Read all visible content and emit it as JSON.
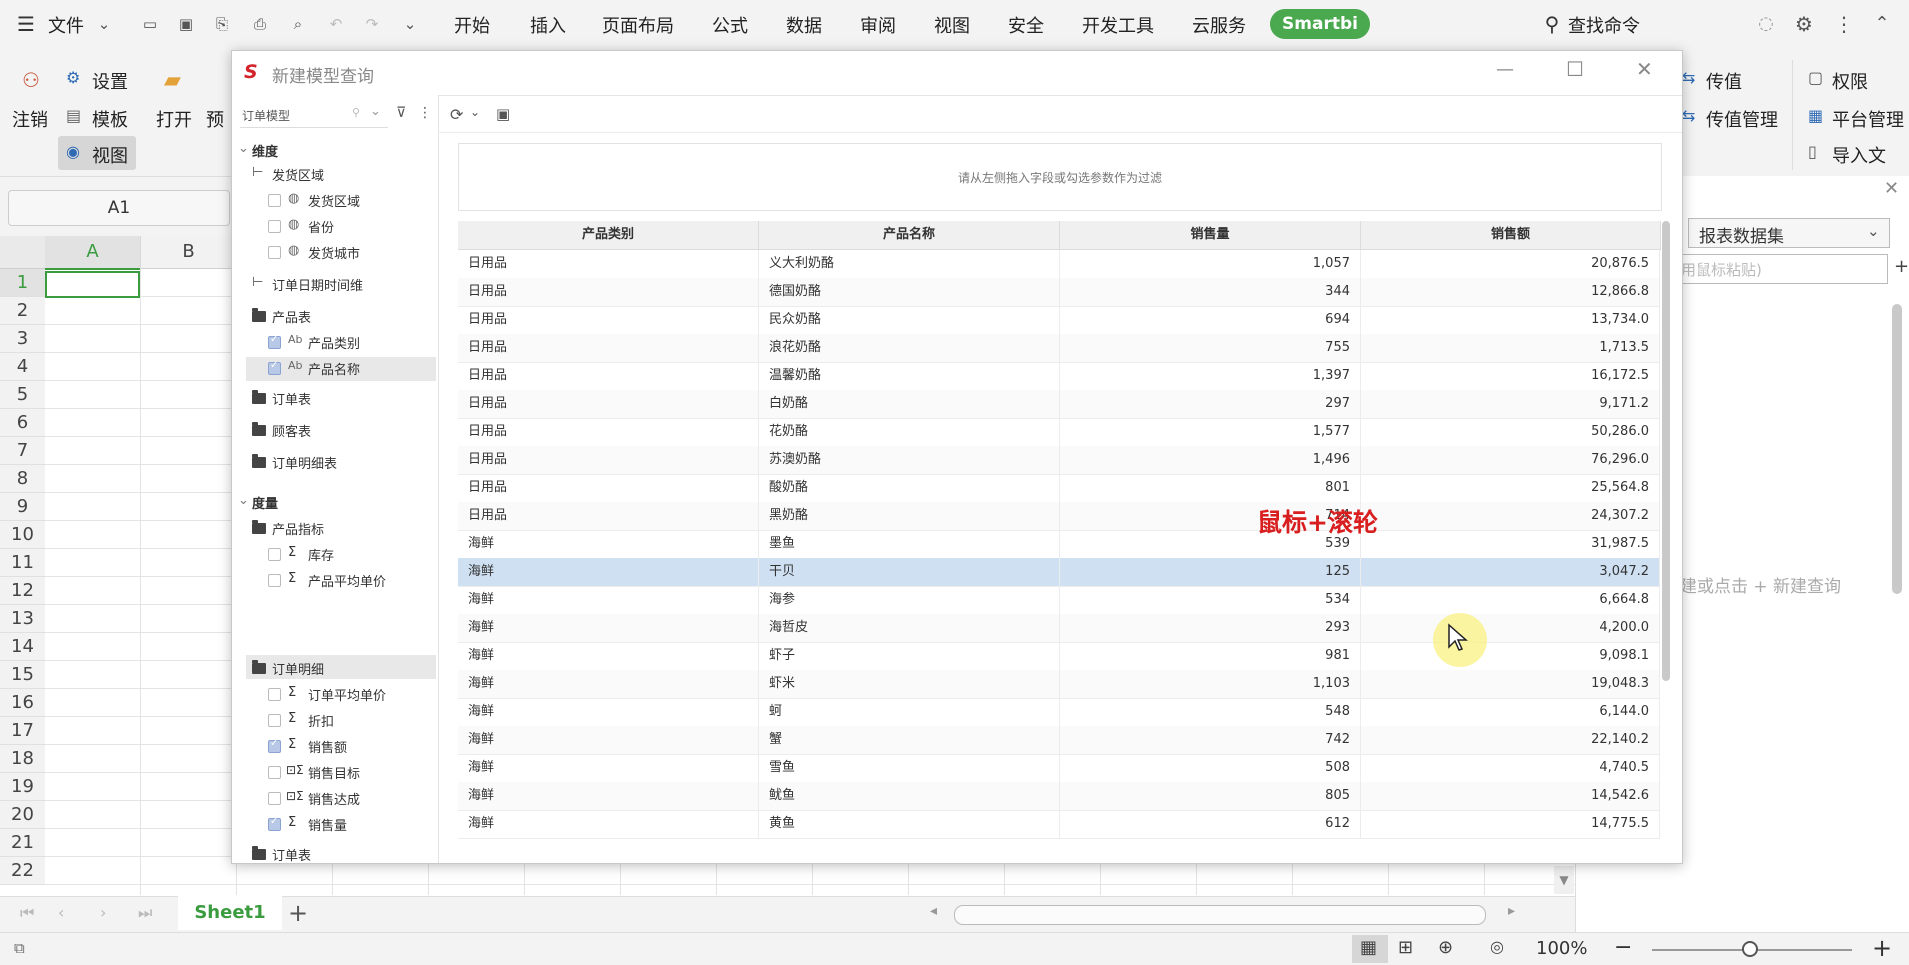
{
  "menubar": {
    "file_label": "文件",
    "items": [
      "开始",
      "插入",
      "页面布局",
      "公式",
      "数据",
      "审阅",
      "视图",
      "安全",
      "开发工具",
      "云服务"
    ],
    "smartbi_label": "Smartbi",
    "search_label": "查找命令"
  },
  "ribbon": {
    "logout_label": "注销",
    "settings_label": "设置",
    "template_label": "模板",
    "view_label": "视图",
    "open_label": "打开",
    "preview_label": "预",
    "pass_value_label": "传值",
    "pass_value_mgmt_label": "传值管理",
    "permission_label": "权限",
    "platform_mgmt_label": "平台管理",
    "import_label": "导入文"
  },
  "namebox": {
    "value": "A1"
  },
  "grid": {
    "columns": [
      "A",
      "B"
    ],
    "rows": [
      "1",
      "2",
      "3",
      "4",
      "5",
      "6",
      "7",
      "8",
      "9",
      "10",
      "11",
      "12",
      "13",
      "14",
      "15",
      "16",
      "17",
      "18",
      "19",
      "20",
      "21",
      "22"
    ]
  },
  "sheet": {
    "tab_label": "Sheet1"
  },
  "statusbar": {
    "zoom": "100%"
  },
  "rightpane": {
    "dataset_label": "报表数据集",
    "paste_hint": "用鼠标粘贴)",
    "new_query_hint": "建或点击 + 新建查询"
  },
  "dialog": {
    "title": "新建模型查询",
    "model_select": "订单模型",
    "filter_hint": "请从左侧拖入字段或勾选参数作为过滤",
    "annotation": "鼠标+滚轮",
    "tree": {
      "dimension": "维度",
      "ship_region": "发货区域",
      "ship_region_field": "发货区域",
      "province": "省份",
      "ship_city": "发货城市",
      "order_date_dim": "订单日期时间维",
      "product_table": "产品表",
      "product_category": "产品类别",
      "product_name": "产品名称",
      "order_table": "订单表",
      "customer_table": "顾客表",
      "order_detail_table": "订单明细表",
      "measure": "度量",
      "product_metrics": "产品指标",
      "stock": "库存",
      "avg_price": "产品平均单价",
      "order_detail": "订单明细",
      "order_avg_price": "订单平均单价",
      "discount": "折扣",
      "sales_amount": "销售额",
      "sales_target": "销售目标",
      "sales_achieved": "销售达成",
      "sales_qty": "销售量",
      "order_table2": "订单表"
    },
    "table": {
      "headers": [
        "产品类别",
        "产品名称",
        "销售量",
        "销售额"
      ],
      "rows": [
        [
          "日用品",
          "义大利奶酪",
          "1,057",
          "20,876.5"
        ],
        [
          "日用品",
          "德国奶酪",
          "344",
          "12,866.8"
        ],
        [
          "日用品",
          "民众奶酪",
          "694",
          "13,734.0"
        ],
        [
          "日用品",
          "浪花奶酪",
          "755",
          "1,713.5"
        ],
        [
          "日用品",
          "温馨奶酪",
          "1,397",
          "16,172.5"
        ],
        [
          "日用品",
          "白奶酪",
          "297",
          "9,171.2"
        ],
        [
          "日用品",
          "花奶酪",
          "1,577",
          "50,286.0"
        ],
        [
          "日用品",
          "苏澳奶酪",
          "1,496",
          "76,296.0"
        ],
        [
          "日用品",
          "酸奶酪",
          "801",
          "25,564.8"
        ],
        [
          "日用品",
          "黑奶酪",
          "714",
          "24,307.2"
        ],
        [
          "海鲜",
          "墨鱼",
          "539",
          "31,987.5"
        ],
        [
          "海鲜",
          "干贝",
          "125",
          "3,047.2"
        ],
        [
          "海鲜",
          "海参",
          "534",
          "6,664.8"
        ],
        [
          "海鲜",
          "海哲皮",
          "293",
          "4,200.0"
        ],
        [
          "海鲜",
          "虾子",
          "981",
          "9,098.1"
        ],
        [
          "海鲜",
          "虾米",
          "1,103",
          "19,048.3"
        ],
        [
          "海鲜",
          "蚵",
          "548",
          "6,144.0"
        ],
        [
          "海鲜",
          "蟹",
          "742",
          "22,140.2"
        ],
        [
          "海鲜",
          "雪鱼",
          "508",
          "4,740.5"
        ],
        [
          "海鲜",
          "鱿鱼",
          "805",
          "14,542.6"
        ],
        [
          "海鲜",
          "黄鱼",
          "612",
          "14,775.5"
        ]
      ]
    }
  }
}
